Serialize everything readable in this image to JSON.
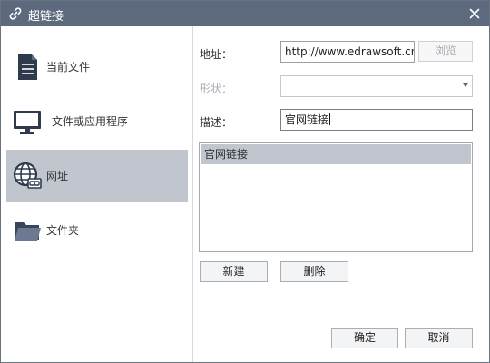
{
  "window": {
    "title": "超链接",
    "title_icon": "link-icon",
    "close_icon": "close-icon"
  },
  "nav": {
    "items": [
      {
        "label": "当前文件",
        "icon": "document-icon",
        "selected": false
      },
      {
        "label": "文件或应用程序",
        "icon": "monitor-icon",
        "selected": false
      },
      {
        "label": "网址",
        "icon": "globe-link-icon",
        "selected": true
      },
      {
        "label": "文件夹",
        "icon": "folder-icon",
        "selected": false
      }
    ]
  },
  "form": {
    "address_label": "地址：",
    "address_value": "http://www.edrawsoft.cn",
    "browse_label": "浏览",
    "shape_label": "形状：",
    "shape_value": "",
    "description_label": "描述：",
    "description_value": "官网链接"
  },
  "link_list": {
    "items": [
      "官网链接"
    ],
    "selected_index": 0
  },
  "actions": {
    "new_label": "新建",
    "delete_label": "删除",
    "ok_label": "确定",
    "cancel_label": "取消"
  },
  "colors": {
    "titlebar": "#5d6a7e",
    "selection": "#c0c5ce",
    "disabled_text": "#a7abb3"
  }
}
